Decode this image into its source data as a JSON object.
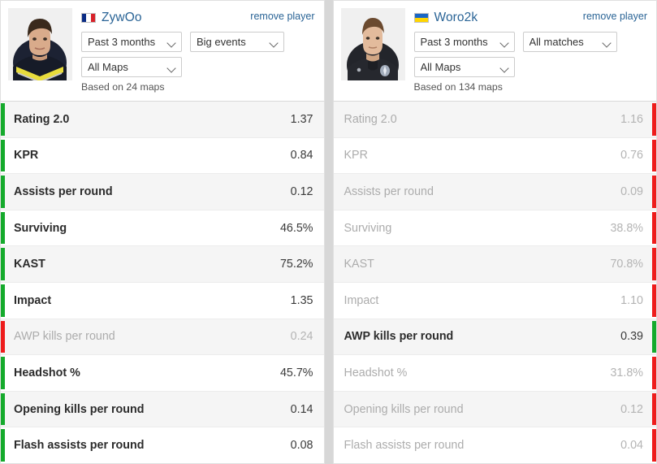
{
  "players": [
    {
      "side": "left",
      "name": "ZywOo",
      "flag": "fr",
      "flag_name": "france-flag-icon",
      "remove_label": "remove player",
      "avatar_name": "player-avatar-zywoo",
      "filters": {
        "period": "Past 3 months",
        "period_options": [
          "Past 3 months"
        ],
        "events": "Big events",
        "events_options": [
          "Big events"
        ],
        "maps": "All Maps",
        "maps_options": [
          "All Maps"
        ]
      },
      "based_on": "Based on 24 maps",
      "stats": [
        {
          "label": "Rating 2.0",
          "value": "1.37",
          "outcome": "win"
        },
        {
          "label": "KPR",
          "value": "0.84",
          "outcome": "win"
        },
        {
          "label": "Assists per round",
          "value": "0.12",
          "outcome": "win"
        },
        {
          "label": "Surviving",
          "value": "46.5%",
          "outcome": "win"
        },
        {
          "label": "KAST",
          "value": "75.2%",
          "outcome": "win"
        },
        {
          "label": "Impact",
          "value": "1.35",
          "outcome": "win"
        },
        {
          "label": "AWP kills per round",
          "value": "0.24",
          "outcome": "lose"
        },
        {
          "label": "Headshot %",
          "value": "45.7%",
          "outcome": "win"
        },
        {
          "label": "Opening kills per round",
          "value": "0.14",
          "outcome": "win"
        },
        {
          "label": "Flash assists per round",
          "value": "0.08",
          "outcome": "win"
        }
      ]
    },
    {
      "side": "right",
      "name": "Woro2k",
      "flag": "ua",
      "flag_name": "ukraine-flag-icon",
      "remove_label": "remove player",
      "avatar_name": "player-avatar-woro2k",
      "filters": {
        "period": "Past 3 months",
        "period_options": [
          "Past 3 months"
        ],
        "events": "All matches",
        "events_options": [
          "All matches"
        ],
        "maps": "All Maps",
        "maps_options": [
          "All Maps"
        ]
      },
      "based_on": "Based on 134 maps",
      "stats": [
        {
          "label": "Rating 2.0",
          "value": "1.16",
          "outcome": "lose"
        },
        {
          "label": "KPR",
          "value": "0.76",
          "outcome": "lose"
        },
        {
          "label": "Assists per round",
          "value": "0.09",
          "outcome": "lose"
        },
        {
          "label": "Surviving",
          "value": "38.8%",
          "outcome": "lose"
        },
        {
          "label": "KAST",
          "value": "70.8%",
          "outcome": "lose"
        },
        {
          "label": "Impact",
          "value": "1.10",
          "outcome": "lose"
        },
        {
          "label": "AWP kills per round",
          "value": "0.39",
          "outcome": "win"
        },
        {
          "label": "Headshot %",
          "value": "31.8%",
          "outcome": "lose"
        },
        {
          "label": "Opening kills per round",
          "value": "0.12",
          "outcome": "lose"
        },
        {
          "label": "Flash assists per round",
          "value": "0.04",
          "outcome": "lose"
        }
      ]
    }
  ],
  "colors": {
    "win_bar": "#15aa2c",
    "lose_bar": "#ee1c1c",
    "link": "#2a6496",
    "row_alt": "#f5f5f5",
    "page_bg": "#d7d7d7"
  }
}
